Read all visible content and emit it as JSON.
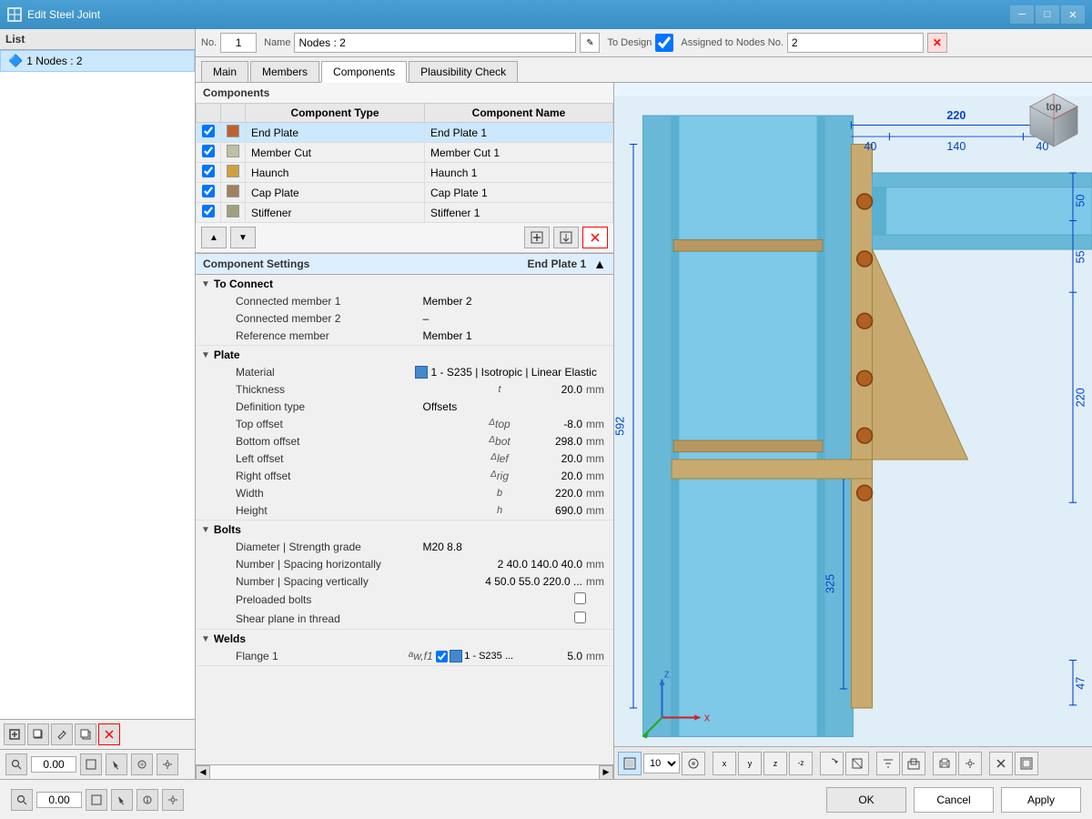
{
  "titlebar": {
    "title": "Edit Steel Joint",
    "min_btn": "─",
    "max_btn": "□",
    "close_btn": "✕"
  },
  "left_panel": {
    "header": "List",
    "items": [
      {
        "id": 1,
        "label": "1  Nodes : 2",
        "selected": true
      }
    ],
    "toolbar": {
      "btn1": "⊞",
      "btn2": "⧉",
      "btn3": "✎",
      "btn4": "⧉",
      "delete_btn": "✕"
    },
    "num_display": "0.00"
  },
  "header": {
    "no_label": "No.",
    "no_value": "1",
    "name_label": "Name",
    "name_value": "Nodes : 2",
    "to_design_label": "To Design",
    "assigned_label": "Assigned to Nodes No.",
    "assigned_value": "2"
  },
  "tabs": [
    {
      "id": "main",
      "label": "Main",
      "active": false
    },
    {
      "id": "members",
      "label": "Members",
      "active": false
    },
    {
      "id": "components",
      "label": "Components",
      "active": true
    },
    {
      "id": "plausibility",
      "label": "Plausibility Check",
      "active": false
    }
  ],
  "components": {
    "header": "Components",
    "col1": "Component Type",
    "col2": "Component Name",
    "rows": [
      {
        "checked": true,
        "color": "#c06030",
        "type": "End Plate",
        "name": "End Plate 1",
        "selected": true
      },
      {
        "checked": true,
        "color": "#c0c0a0",
        "type": "Member Cut",
        "name": "Member Cut 1",
        "selected": false
      },
      {
        "checked": true,
        "color": "#d0a040",
        "type": "Haunch",
        "name": "Haunch 1",
        "selected": false
      },
      {
        "checked": true,
        "color": "#a08060",
        "type": "Cap Plate",
        "name": "Cap Plate 1",
        "selected": false
      },
      {
        "checked": true,
        "color": "#a0a080",
        "type": "Stiffener",
        "name": "Stiffener 1",
        "selected": false
      }
    ],
    "toolbar_btns": [
      "⬆",
      "⬇",
      "📋",
      "📤",
      "✕"
    ]
  },
  "settings": {
    "title": "Component Settings",
    "selected_name": "End Plate 1",
    "groups": [
      {
        "id": "to_connect",
        "label": "To Connect",
        "rows": [
          {
            "label": "Connected member 1",
            "symbol": "",
            "value": "Member 2",
            "unit": ""
          },
          {
            "label": "Connected member 2",
            "symbol": "",
            "value": "–",
            "unit": ""
          },
          {
            "label": "Reference member",
            "symbol": "",
            "value": "Member 1",
            "unit": ""
          }
        ]
      },
      {
        "id": "plate",
        "label": "Plate",
        "rows": [
          {
            "label": "Material",
            "symbol": "",
            "value": "1 - S235 | Isotropic | Linear Elastic",
            "unit": "",
            "has_mat": true
          },
          {
            "label": "Thickness",
            "symbol": "t",
            "value": "20.0",
            "unit": "mm"
          },
          {
            "label": "Definition type",
            "symbol": "",
            "value": "Offsets",
            "unit": ""
          },
          {
            "label": "Top offset",
            "symbol": "Δtop",
            "value": "-8.0",
            "unit": "mm"
          },
          {
            "label": "Bottom offset",
            "symbol": "Δbot",
            "value": "298.0",
            "unit": "mm"
          },
          {
            "label": "Left offset",
            "symbol": "Δlef",
            "value": "20.0",
            "unit": "mm"
          },
          {
            "label": "Right offset",
            "symbol": "Δrig",
            "value": "20.0",
            "unit": "mm"
          },
          {
            "label": "Width",
            "symbol": "b",
            "value": "220.0",
            "unit": "mm"
          },
          {
            "label": "Height",
            "symbol": "h",
            "value": "690.0",
            "unit": "mm"
          }
        ]
      },
      {
        "id": "bolts",
        "label": "Bolts",
        "rows": [
          {
            "label": "Diameter | Strength grade",
            "symbol": "",
            "value": "M20   8.8",
            "unit": ""
          },
          {
            "label": "Number | Spacing horizontally",
            "symbol": "",
            "value": "2   40.0 140.0 40.0",
            "unit": "mm"
          },
          {
            "label": "Number | Spacing vertically",
            "symbol": "",
            "value": "4   50.0 55.0 220.0 ...",
            "unit": "mm"
          },
          {
            "label": "Preloaded bolts",
            "symbol": "",
            "value": "☐",
            "unit": "",
            "is_check": true
          },
          {
            "label": "Shear plane in thread",
            "symbol": "",
            "value": "☐",
            "unit": "",
            "is_check": true
          }
        ]
      },
      {
        "id": "welds",
        "label": "Welds",
        "rows": [
          {
            "label": "Flange 1",
            "symbol": "aw,f1",
            "value": "1 - S235 ...   5.0",
            "unit": "mm",
            "has_mat": true,
            "has_check": true
          }
        ]
      }
    ]
  },
  "view_toolbar": {
    "zoom_value": "10",
    "btns": [
      "🔲",
      "↔",
      "x",
      "y",
      "z",
      "-z",
      "⟳",
      "⬚",
      "✕",
      "⊞",
      "🖨",
      "✕",
      "□"
    ]
  },
  "bottom_bar": {
    "ok_label": "OK",
    "cancel_label": "Cancel",
    "apply_label": "Apply"
  },
  "bottom_left_tools": {
    "btns": [
      "🔍",
      "0.00",
      "⬚",
      "✎",
      "📋",
      "⚙"
    ]
  },
  "dimensions": {
    "top_220": "220",
    "top_40_left": "40",
    "top_140": "140",
    "top_40_right": "40",
    "right_50": "50",
    "right_55": "55",
    "right_220": "220",
    "right_592": "592",
    "right_325": "325",
    "right_47": "47"
  }
}
